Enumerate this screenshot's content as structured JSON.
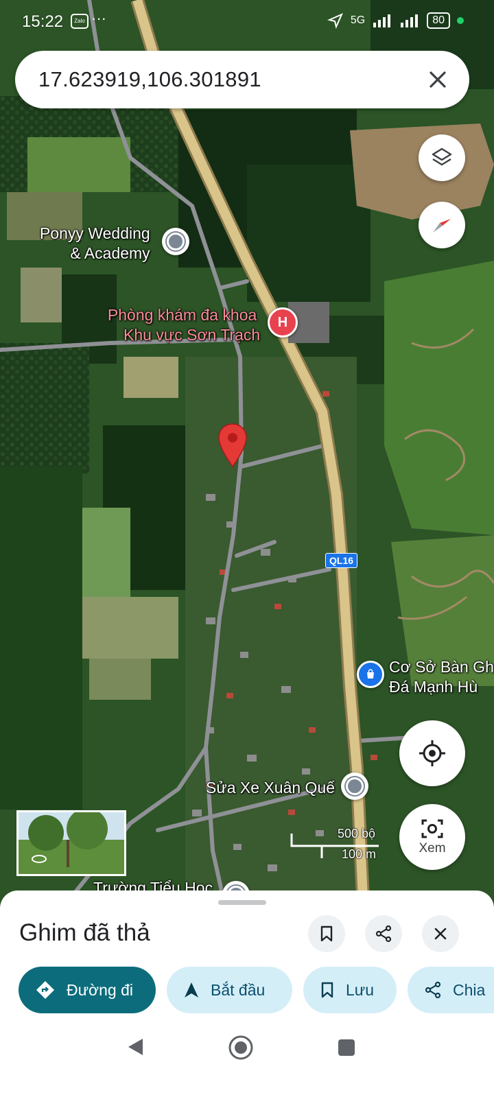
{
  "status": {
    "time": "15:22",
    "zalo": "Zalo",
    "more": "···",
    "network": "5G",
    "battery": "80"
  },
  "search": {
    "query": "17.623919,106.301891"
  },
  "map": {
    "places": [
      {
        "line1": "Ponyy Wedding",
        "line2": "& Academy"
      },
      {
        "line1": "Phòng khám đa khoa",
        "line2": "Khu vực Sơn Trạch"
      },
      {
        "line1": "Cơ Sở Bàn Gh",
        "line2": "Đá Mạnh Hù"
      },
      {
        "line1": "Sửa Xe Xuân Quế",
        "line2": ""
      },
      {
        "line1": "Trường Tiểu Học",
        "line2": ""
      }
    ],
    "hospital_marker": "H",
    "highway": "QL16",
    "scale": {
      "imperial": "500 bộ",
      "metric": "100 m"
    }
  },
  "controls": {
    "lens_label": "Xem"
  },
  "sheet": {
    "title": "Ghim đã thả",
    "chips": [
      "Đường đi",
      "Bắt đầu",
      "Lưu",
      "Chia"
    ]
  },
  "colors": {
    "primary": "#0c6c7b",
    "chip": "#d4eef8",
    "pin": "#e53935"
  }
}
